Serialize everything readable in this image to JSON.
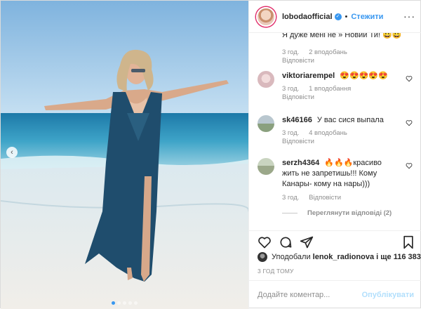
{
  "header": {
    "username": "lobodaofficial",
    "verified_icon": "verified-badge-icon",
    "separator": "•",
    "follow_label": "Стежити",
    "more_label": "···"
  },
  "comments": {
    "top_cut_text": "Я дуже мені не » Новий Ти! 😀😀",
    "top_meta": {
      "time": "3 год.",
      "likes": "2 вподобань",
      "reply": "Відповісти"
    },
    "items": [
      {
        "user": "viktoriarempel",
        "text": "😍😍😍😍😍",
        "time": "3 год.",
        "likes": "1 вподобання",
        "reply": "Відповісти"
      },
      {
        "user": "sk46166",
        "text": "У вас сися выпала",
        "time": "3 год.",
        "likes": "4 вподобань",
        "reply": "Відповісти"
      },
      {
        "user": "serzh4364",
        "text": "🔥🔥🔥красиво жить не запретишь!!! Кому Канары- кому на нары)))",
        "time": "3 год.",
        "likes": "",
        "reply": "Відповісти"
      }
    ],
    "view_replies": "Переглянути відповіді (2)"
  },
  "actions": {
    "like_icon": "heart-icon",
    "comment_icon": "comment-icon",
    "share_icon": "share-icon",
    "save_icon": "bookmark-icon"
  },
  "likes": {
    "prefix": "Уподобали",
    "user": "lenok_radionova",
    "suffix": "і ще 116 383"
  },
  "time_ago": "3 ГОД ТОМУ",
  "add_comment": {
    "placeholder": "Додайте коментар...",
    "publish_label": "Опублікувати"
  },
  "colors": {
    "accent": "#3897f0",
    "publish_disabled": "#b2dffc",
    "secondary_text": "#8e8e8e"
  },
  "carousel": {
    "arrow_icon": "chevron-left-icon",
    "total_slides": 5,
    "active_slide": 1
  }
}
